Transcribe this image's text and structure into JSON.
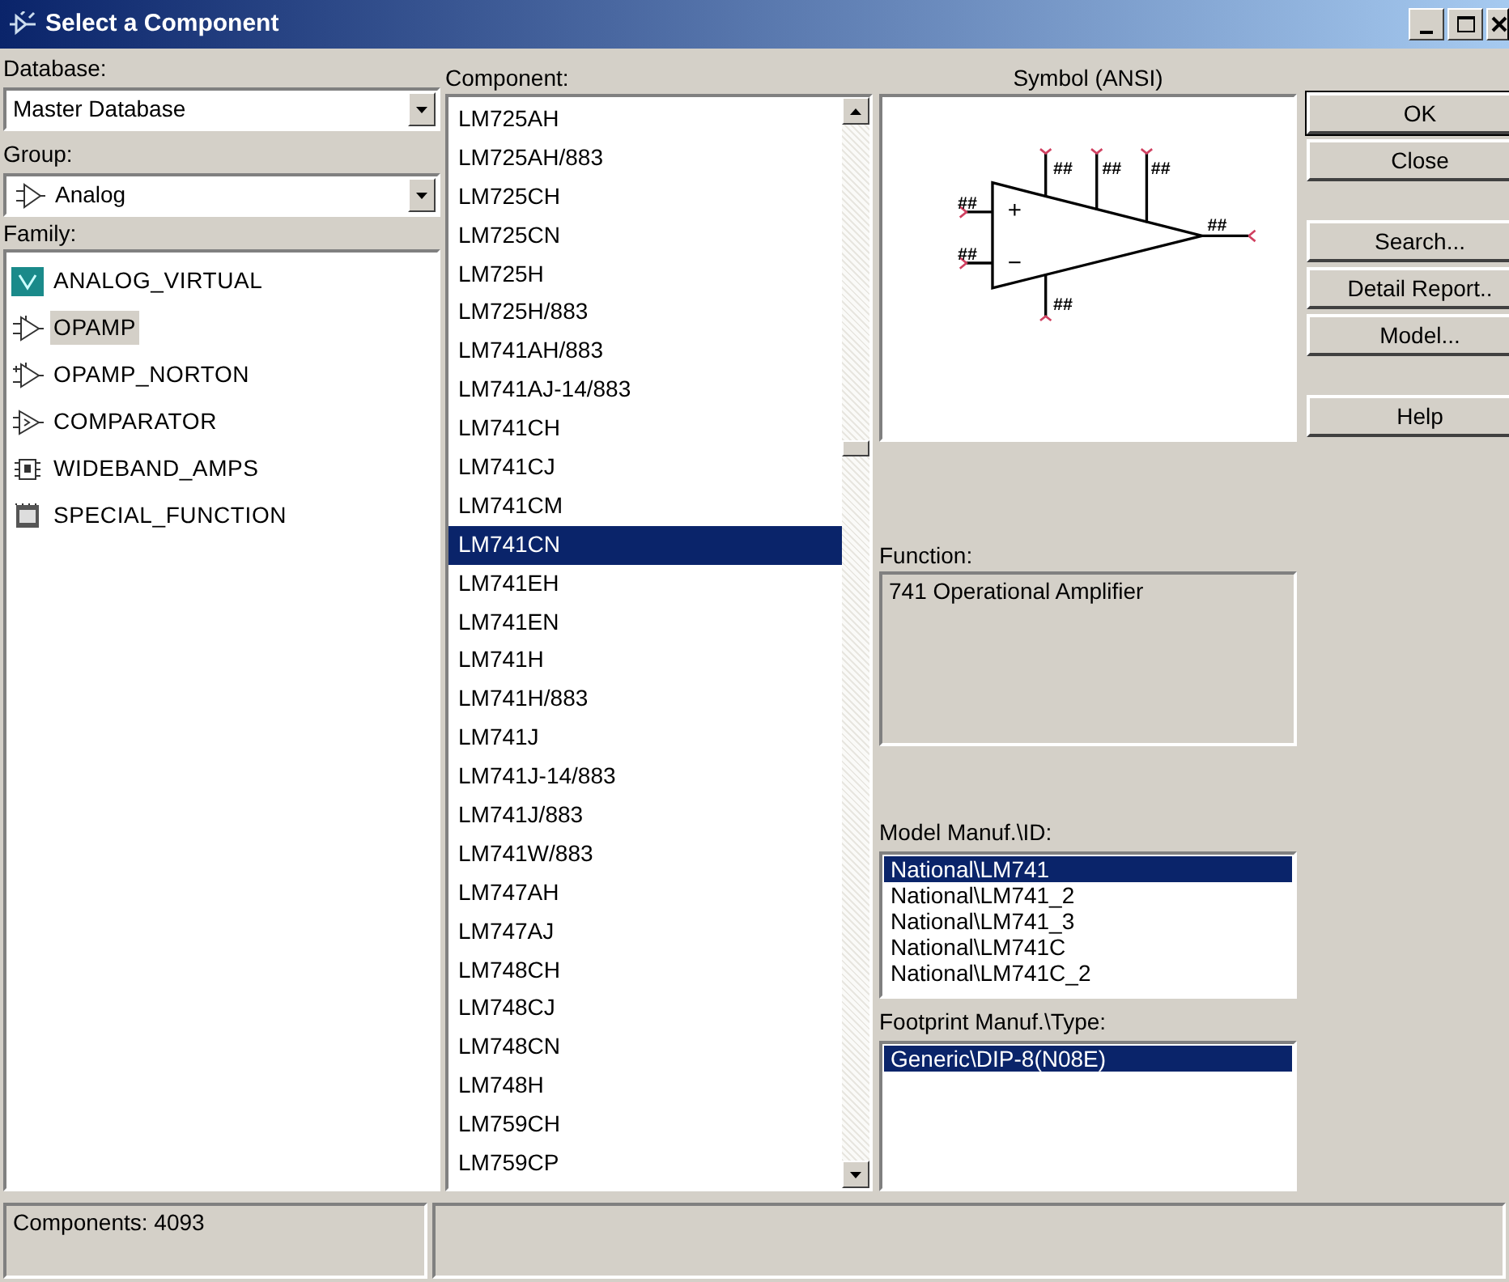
{
  "window": {
    "title": "Select a Component"
  },
  "database": {
    "label": "Database:",
    "value": "Master Database"
  },
  "group": {
    "label": "Group:",
    "value": "Analog"
  },
  "family": {
    "label": "Family:",
    "items": [
      {
        "label": "ANALOG_VIRTUAL",
        "kind": "virtual",
        "selected": false
      },
      {
        "label": "OPAMP",
        "kind": "opamp",
        "selected": true
      },
      {
        "label": "OPAMP_NORTON",
        "kind": "norton",
        "selected": false
      },
      {
        "label": "COMPARATOR",
        "kind": "comparator",
        "selected": false
      },
      {
        "label": "WIDEBAND_AMPS",
        "kind": "wideband",
        "selected": false
      },
      {
        "label": "SPECIAL_FUNCTION",
        "kind": "special",
        "selected": false
      }
    ]
  },
  "component": {
    "label": "Component:",
    "items": [
      {
        "label": "LM725AH",
        "selected": false
      },
      {
        "label": "LM725AH/883",
        "selected": false
      },
      {
        "label": "LM725CH",
        "selected": false
      },
      {
        "label": "LM725CN",
        "selected": false
      },
      {
        "label": "LM725H",
        "selected": false
      },
      {
        "label": "LM725H/883",
        "selected": false
      },
      {
        "label": "LM741AH/883",
        "selected": false
      },
      {
        "label": "LM741AJ-14/883",
        "selected": false
      },
      {
        "label": "LM741CH",
        "selected": false
      },
      {
        "label": "LM741CJ",
        "selected": false
      },
      {
        "label": "LM741CM",
        "selected": false
      },
      {
        "label": "LM741CN",
        "selected": true
      },
      {
        "label": "LM741EH",
        "selected": false
      },
      {
        "label": "LM741EN",
        "selected": false
      },
      {
        "label": "LM741H",
        "selected": false
      },
      {
        "label": "LM741H/883",
        "selected": false
      },
      {
        "label": "LM741J",
        "selected": false
      },
      {
        "label": "LM741J-14/883",
        "selected": false
      },
      {
        "label": "LM741J/883",
        "selected": false
      },
      {
        "label": "LM741W/883",
        "selected": false
      },
      {
        "label": "LM747AH",
        "selected": false
      },
      {
        "label": "LM747AJ",
        "selected": false
      },
      {
        "label": "LM748CH",
        "selected": false
      },
      {
        "label": "LM748CJ",
        "selected": false
      },
      {
        "label": "LM748CN",
        "selected": false
      },
      {
        "label": "LM748H",
        "selected": false
      },
      {
        "label": "LM759CH",
        "selected": false
      },
      {
        "label": "LM759CP",
        "selected": false
      }
    ]
  },
  "symbol": {
    "title": "Symbol (ANSI)",
    "plus": "+",
    "minus": "−",
    "pin_labels": [
      "##",
      "##",
      "##",
      "##",
      "##",
      "##",
      "##"
    ]
  },
  "function": {
    "label": "Function:",
    "value": "741 Operational Amplifier"
  },
  "model": {
    "label": "Model Manuf.\\ID:",
    "items": [
      {
        "label": "National\\LM741",
        "selected": true
      },
      {
        "label": "National\\LM741_2",
        "selected": false
      },
      {
        "label": "National\\LM741_3",
        "selected": false
      },
      {
        "label": "National\\LM741C",
        "selected": false
      },
      {
        "label": "National\\LM741C_2",
        "selected": false
      }
    ]
  },
  "footprint": {
    "label": "Footprint Manuf.\\Type:",
    "items": [
      {
        "label": "Generic\\DIP-8(N08E)",
        "selected": true
      }
    ]
  },
  "buttons": [
    {
      "label": "OK",
      "kind": "default"
    },
    {
      "label": "Close",
      "kind": "normal"
    },
    {
      "label": "Search...",
      "kind": "gap"
    },
    {
      "label": "Detail Report..",
      "kind": "normal"
    },
    {
      "label": "Model...",
      "kind": "normal"
    },
    {
      "label": "Help",
      "kind": "gap"
    }
  ],
  "status_bar": {
    "count": "Components: 4093"
  }
}
